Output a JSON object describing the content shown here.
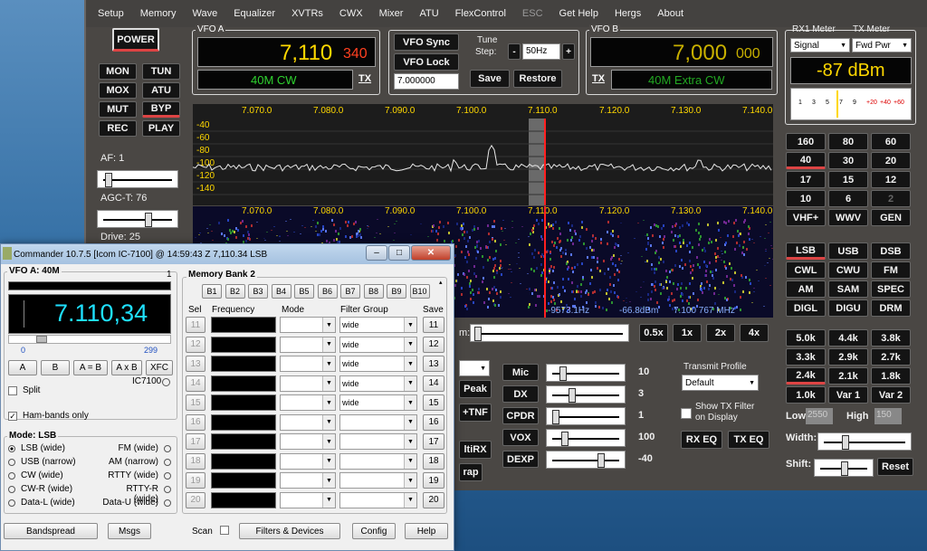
{
  "psdr": {
    "menu": [
      {
        "label": "Setup"
      },
      {
        "label": "Memory"
      },
      {
        "label": "Wave"
      },
      {
        "label": "Equalizer"
      },
      {
        "label": "XVTRs"
      },
      {
        "label": "CWX"
      },
      {
        "label": "Mixer"
      },
      {
        "label": "ATU"
      },
      {
        "label": "FlexControl"
      },
      {
        "label": "ESC"
      },
      {
        "label": "Get Help"
      },
      {
        "label": "Hergs"
      },
      {
        "label": "About"
      }
    ],
    "power": "POWER",
    "mode_buttons": [
      [
        "MON",
        "TUN"
      ],
      [
        "MOX",
        "ATU"
      ],
      [
        "MUT",
        "BYP"
      ],
      [
        "REC",
        "PLAY"
      ]
    ],
    "af_label": "AF:  1",
    "agc_label": "AGC-T:  76",
    "drive_label": "Drive:  25",
    "vfoa": {
      "title": "VFO A",
      "freq": "7,110",
      "freq_small": "340",
      "band": "40M CW",
      "tx": "TX"
    },
    "vfo_sync": "VFO Sync",
    "vfo_lock": "VFO Lock",
    "tune_label": "Tune",
    "step_label": "Step:",
    "step_value": "50Hz",
    "minus": "-",
    "plus": "+",
    "mem_value": "7.000000",
    "save": "Save",
    "restore": "Restore",
    "vfob": {
      "title": "VFO B",
      "freq": "7,000",
      "freq_small": "000",
      "band": "40M Extra CW",
      "tx": "TX"
    },
    "rx1_meter": "RX1 Meter",
    "tx_meter": "TX Meter",
    "rx1_sel": "Signal",
    "tx_sel": "Fwd Pwr",
    "meter_value": "-87 dBm",
    "meter_scale": [
      "1",
      "3",
      "5",
      "7",
      "9",
      "+20",
      "+40",
      "+60"
    ],
    "spectrum_ticks": [
      "7.070.0",
      "7.080.0",
      "7.090.0",
      "7.100.0",
      "7.110.0",
      "7.120.0",
      "7.130.0",
      "7.140.0"
    ],
    "db_labels": [
      "-40",
      "-60",
      "-80",
      "-100",
      "-120",
      "-140"
    ],
    "waterfall_ticks": [
      "7.070.0",
      "7.080.0",
      "7.090.0",
      "7.100.0",
      "7.110.0",
      "7.120.0",
      "7.130.0",
      "7.140.0"
    ],
    "readout": {
      "hz": "-9573.1Hz",
      "dbm": "-66.8dBm",
      "mhz": "7.100 767 MHz"
    },
    "zoom_label": "m:",
    "zoom_buttons": [
      "0.5x",
      "1x",
      "2x",
      "4x"
    ],
    "bands": [
      "160",
      "80",
      "60",
      "40",
      "30",
      "20",
      "17",
      "15",
      "12",
      "10",
      "6",
      "2",
      "VHF+",
      "WWV",
      "GEN"
    ],
    "modes": [
      "LSB",
      "USB",
      "DSB",
      "CWL",
      "CWU",
      "FM",
      "AM",
      "SAM",
      "SPEC",
      "DIGL",
      "DIGU",
      "DRM"
    ],
    "filters": [
      "5.0k",
      "4.4k",
      "3.8k",
      "3.3k",
      "2.9k",
      "2.7k",
      "2.4k",
      "2.1k",
      "1.8k",
      "1.0k",
      "Var 1",
      "Var 2"
    ],
    "low_label": "Low",
    "low_value": "2550",
    "high_label": "High",
    "high_value": "150",
    "width_label": "Width:",
    "shift_label": "Shift:",
    "reset": "Reset",
    "dsp_buttons": [
      "Peak",
      "+TNF",
      "ltiRX",
      "rap"
    ],
    "tx_controls": [
      {
        "label": "Mic",
        "value": "10"
      },
      {
        "label": "DX",
        "value": "3"
      },
      {
        "label": "CPDR",
        "value": "1"
      },
      {
        "label": "VOX",
        "value": "100"
      },
      {
        "label": "DEXP",
        "value": "-40"
      }
    ],
    "transmit_profile_label": "Transmit Profile",
    "transmit_profile_value": "Default",
    "show_tx_filter": "Show TX Filter\non Display",
    "rx_eq": "RX EQ",
    "tx_eq": "TX EQ"
  },
  "cmd": {
    "title": "Commander 10.7.5 [Icom IC-7100] @ 14:59:43 Z  7,110.34 LSB",
    "min": "–",
    "max": "□",
    "close": "✕",
    "vfo_label": "VFO A: 40M",
    "vfo_num": "1",
    "freq": "7.110,34",
    "scale_min": "0",
    "scale_max": "299",
    "btn_a": "A",
    "btn_b": "B",
    "btn_aeqb": "A = B",
    "btn_axb": "A x B",
    "btn_xfc": "XFC",
    "radio_name": "IC7100",
    "split": "Split",
    "ham_bands": "Ham-bands only",
    "mode_title": "Mode: LSB",
    "modes_left": [
      "LSB (wide)",
      "USB (narrow)",
      "CW (wide)",
      "CW-R (wide)",
      "Data-L (wide)"
    ],
    "modes_right": [
      "FM (wide)",
      "AM (narrow)",
      "RTTY (wide)",
      "RTTY-R (wide)",
      "Data-U (wide)"
    ],
    "mem_title": "Memory Bank 2",
    "banks": [
      "B1",
      "B2",
      "B3",
      "B4",
      "B5",
      "B6",
      "B7",
      "B8",
      "B9",
      "B10"
    ],
    "col_sel": "Sel",
    "col_freq": "Frequency",
    "col_mode": "Mode",
    "col_filter": "Filter Group",
    "col_save": "Save",
    "rows": [
      {
        "n": "11",
        "f": "wide"
      },
      {
        "n": "12",
        "f": "wide"
      },
      {
        "n": "13",
        "f": "wide"
      },
      {
        "n": "14",
        "f": "wide"
      },
      {
        "n": "15",
        "f": "wide"
      },
      {
        "n": "16",
        "f": ""
      },
      {
        "n": "17",
        "f": ""
      },
      {
        "n": "18",
        "f": ""
      },
      {
        "n": "19",
        "f": ""
      },
      {
        "n": "20",
        "f": ""
      }
    ],
    "bandspread": "Bandspread",
    "msgs": "Msgs",
    "scan": "Scan",
    "filters_devices": "Filters & Devices",
    "config": "Config",
    "help": "Help"
  },
  "colors": {
    "accent_yellow": "#ffd800",
    "accent_green": "#2fd22f",
    "accent_cyan": "#1fe0ff",
    "tune_line": "#ff2020"
  }
}
